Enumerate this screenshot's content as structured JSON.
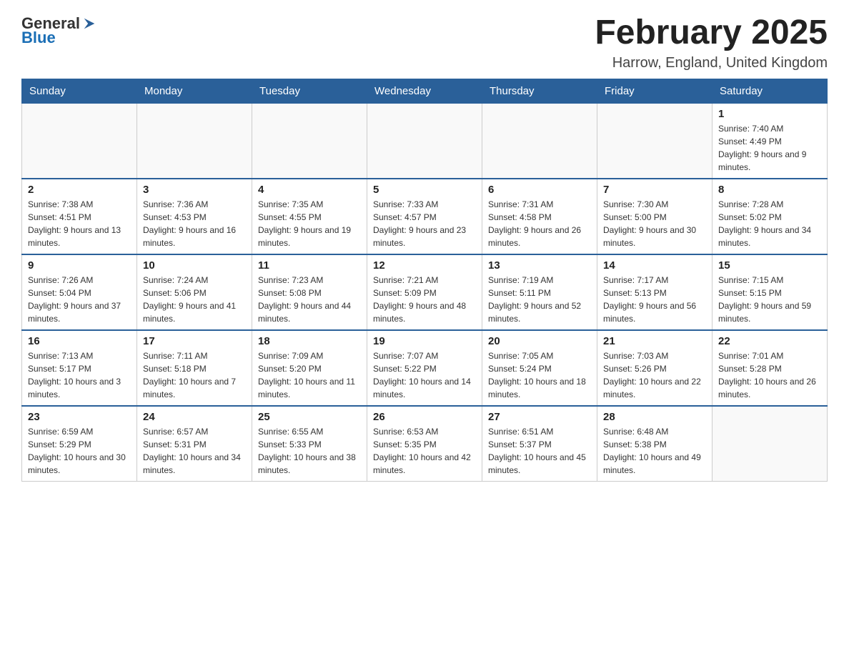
{
  "header": {
    "logo_general": "General",
    "logo_blue": "Blue",
    "month": "February 2025",
    "location": "Harrow, England, United Kingdom"
  },
  "days_of_week": [
    "Sunday",
    "Monday",
    "Tuesday",
    "Wednesday",
    "Thursday",
    "Friday",
    "Saturday"
  ],
  "weeks": [
    {
      "days": [
        {
          "num": "",
          "info": ""
        },
        {
          "num": "",
          "info": ""
        },
        {
          "num": "",
          "info": ""
        },
        {
          "num": "",
          "info": ""
        },
        {
          "num": "",
          "info": ""
        },
        {
          "num": "",
          "info": ""
        },
        {
          "num": "1",
          "info": "Sunrise: 7:40 AM\nSunset: 4:49 PM\nDaylight: 9 hours and 9 minutes."
        }
      ]
    },
    {
      "days": [
        {
          "num": "2",
          "info": "Sunrise: 7:38 AM\nSunset: 4:51 PM\nDaylight: 9 hours and 13 minutes."
        },
        {
          "num": "3",
          "info": "Sunrise: 7:36 AM\nSunset: 4:53 PM\nDaylight: 9 hours and 16 minutes."
        },
        {
          "num": "4",
          "info": "Sunrise: 7:35 AM\nSunset: 4:55 PM\nDaylight: 9 hours and 19 minutes."
        },
        {
          "num": "5",
          "info": "Sunrise: 7:33 AM\nSunset: 4:57 PM\nDaylight: 9 hours and 23 minutes."
        },
        {
          "num": "6",
          "info": "Sunrise: 7:31 AM\nSunset: 4:58 PM\nDaylight: 9 hours and 26 minutes."
        },
        {
          "num": "7",
          "info": "Sunrise: 7:30 AM\nSunset: 5:00 PM\nDaylight: 9 hours and 30 minutes."
        },
        {
          "num": "8",
          "info": "Sunrise: 7:28 AM\nSunset: 5:02 PM\nDaylight: 9 hours and 34 minutes."
        }
      ]
    },
    {
      "days": [
        {
          "num": "9",
          "info": "Sunrise: 7:26 AM\nSunset: 5:04 PM\nDaylight: 9 hours and 37 minutes."
        },
        {
          "num": "10",
          "info": "Sunrise: 7:24 AM\nSunset: 5:06 PM\nDaylight: 9 hours and 41 minutes."
        },
        {
          "num": "11",
          "info": "Sunrise: 7:23 AM\nSunset: 5:08 PM\nDaylight: 9 hours and 44 minutes."
        },
        {
          "num": "12",
          "info": "Sunrise: 7:21 AM\nSunset: 5:09 PM\nDaylight: 9 hours and 48 minutes."
        },
        {
          "num": "13",
          "info": "Sunrise: 7:19 AM\nSunset: 5:11 PM\nDaylight: 9 hours and 52 minutes."
        },
        {
          "num": "14",
          "info": "Sunrise: 7:17 AM\nSunset: 5:13 PM\nDaylight: 9 hours and 56 minutes."
        },
        {
          "num": "15",
          "info": "Sunrise: 7:15 AM\nSunset: 5:15 PM\nDaylight: 9 hours and 59 minutes."
        }
      ]
    },
    {
      "days": [
        {
          "num": "16",
          "info": "Sunrise: 7:13 AM\nSunset: 5:17 PM\nDaylight: 10 hours and 3 minutes."
        },
        {
          "num": "17",
          "info": "Sunrise: 7:11 AM\nSunset: 5:18 PM\nDaylight: 10 hours and 7 minutes."
        },
        {
          "num": "18",
          "info": "Sunrise: 7:09 AM\nSunset: 5:20 PM\nDaylight: 10 hours and 11 minutes."
        },
        {
          "num": "19",
          "info": "Sunrise: 7:07 AM\nSunset: 5:22 PM\nDaylight: 10 hours and 14 minutes."
        },
        {
          "num": "20",
          "info": "Sunrise: 7:05 AM\nSunset: 5:24 PM\nDaylight: 10 hours and 18 minutes."
        },
        {
          "num": "21",
          "info": "Sunrise: 7:03 AM\nSunset: 5:26 PM\nDaylight: 10 hours and 22 minutes."
        },
        {
          "num": "22",
          "info": "Sunrise: 7:01 AM\nSunset: 5:28 PM\nDaylight: 10 hours and 26 minutes."
        }
      ]
    },
    {
      "days": [
        {
          "num": "23",
          "info": "Sunrise: 6:59 AM\nSunset: 5:29 PM\nDaylight: 10 hours and 30 minutes."
        },
        {
          "num": "24",
          "info": "Sunrise: 6:57 AM\nSunset: 5:31 PM\nDaylight: 10 hours and 34 minutes."
        },
        {
          "num": "25",
          "info": "Sunrise: 6:55 AM\nSunset: 5:33 PM\nDaylight: 10 hours and 38 minutes."
        },
        {
          "num": "26",
          "info": "Sunrise: 6:53 AM\nSunset: 5:35 PM\nDaylight: 10 hours and 42 minutes."
        },
        {
          "num": "27",
          "info": "Sunrise: 6:51 AM\nSunset: 5:37 PM\nDaylight: 10 hours and 45 minutes."
        },
        {
          "num": "28",
          "info": "Sunrise: 6:48 AM\nSunset: 5:38 PM\nDaylight: 10 hours and 49 minutes."
        },
        {
          "num": "",
          "info": ""
        }
      ]
    }
  ]
}
